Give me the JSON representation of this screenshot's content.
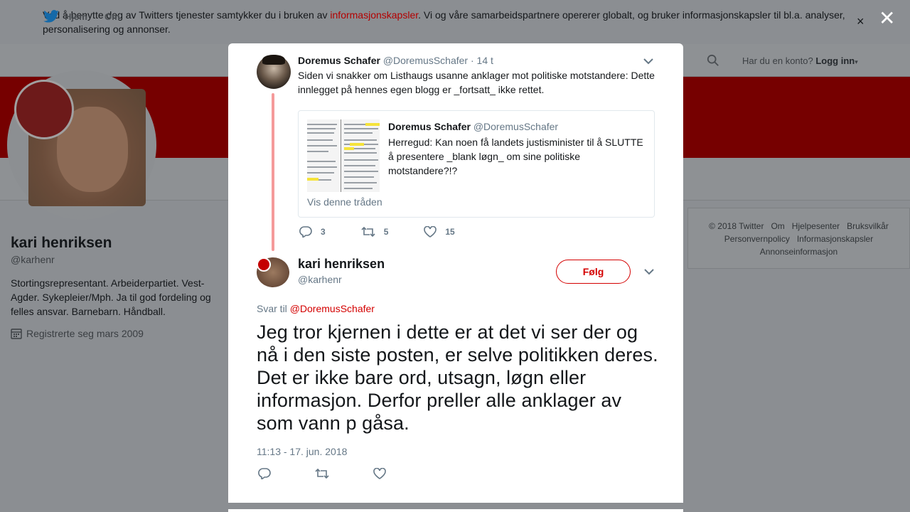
{
  "cookie_bar": {
    "text_before": "Ved å benytte deg av Twitters tjenester samtykker du i bruken av ",
    "link": "informasjonskapsler",
    "text_after": ". Vi og våre samarbeidspartnere opererer globalt, og bruker informasjonskapsler til bl.a. analyser, personalisering og annonser.",
    "close_glyph": "×"
  },
  "nav": {
    "home": "Hjem",
    "about": "Om",
    "account_prompt": "Har du en konto?",
    "login": "Logg inn"
  },
  "profile": {
    "name": "kari henriksen",
    "handle": "@karhenr",
    "bio": "Stortingsrepresentant. Arbeiderpartiet. Vest-Agder. Sykepleier/Mph. Ja til god fordeling og felles ansvar. Barnebarn. Håndball.",
    "joined": "Registrerte seg mars 2009"
  },
  "footer": {
    "links": [
      "© 2018 Twitter",
      "Om",
      "Hjelpesenter",
      "Bruksvilkår",
      "Personvernpolicy",
      "Informasjonskapsler",
      "Annonseinformasjon"
    ]
  },
  "overlay_close": "✕",
  "parent_tweet": {
    "name": "Doremus Schafer",
    "handle": "@DoremusSchafer",
    "time": "· 14 t",
    "text": "Siden vi snakker om Listhaugs usanne anklager mot politiske motstandere: Dette innlegget på hennes egen blogg er _fortsatt_ ikke rettet.",
    "quote": {
      "name": "Doremus Schafer",
      "handle": "@DoremusSchafer",
      "text": "Herregud: Kan noen få landets justisminister til å SLUTTE å presentere _blank løgn_ om sine politiske motstandere?!?",
      "thread_link": "Vis denne tråden"
    },
    "replies": "3",
    "retweets": "5",
    "likes": "15"
  },
  "main_tweet": {
    "name": "kari henriksen",
    "handle": "@karhenr",
    "follow_label": "Følg",
    "reply_prefix": "Svar til ",
    "reply_to": "@DoremusSchafer",
    "text": "Jeg tror kjernen i dette er at det vi ser der og nå i den siste posten, er selve politikken deres. Det er ikke bare ord, utsagn, løgn eller informasjon. Derfor preller alle anklager av som vann p gåsa.",
    "timestamp": "11:13 - 17. jun. 2018"
  },
  "colors": {
    "accent": "#d40000",
    "thread_line": "#f59a9a",
    "muted": "#657786",
    "overlay": "#8b8e92"
  }
}
